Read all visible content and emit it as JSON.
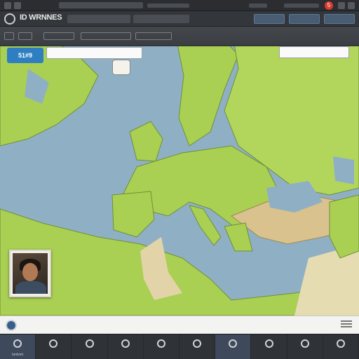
{
  "app": {
    "title": "ID WRNNES"
  },
  "toolbar": {
    "badge": "5"
  },
  "map_controls": {
    "layer_button": "51#9"
  },
  "dock": {
    "items": [
      {
        "label": "lantvmi",
        "active": true
      },
      {
        "label": "",
        "active": false
      },
      {
        "label": "",
        "active": false
      },
      {
        "label": "",
        "active": false
      },
      {
        "label": "",
        "active": false
      },
      {
        "label": "",
        "active": false
      },
      {
        "label": "",
        "active": true
      },
      {
        "label": "",
        "active": false
      },
      {
        "label": "",
        "active": false
      },
      {
        "label": "",
        "active": false
      }
    ]
  },
  "colors": {
    "land": "#a9cf53",
    "water": "#8fb0c4",
    "desert": "#d9c28d",
    "accent": "#2e7fc2",
    "alert": "#d83a2e"
  }
}
